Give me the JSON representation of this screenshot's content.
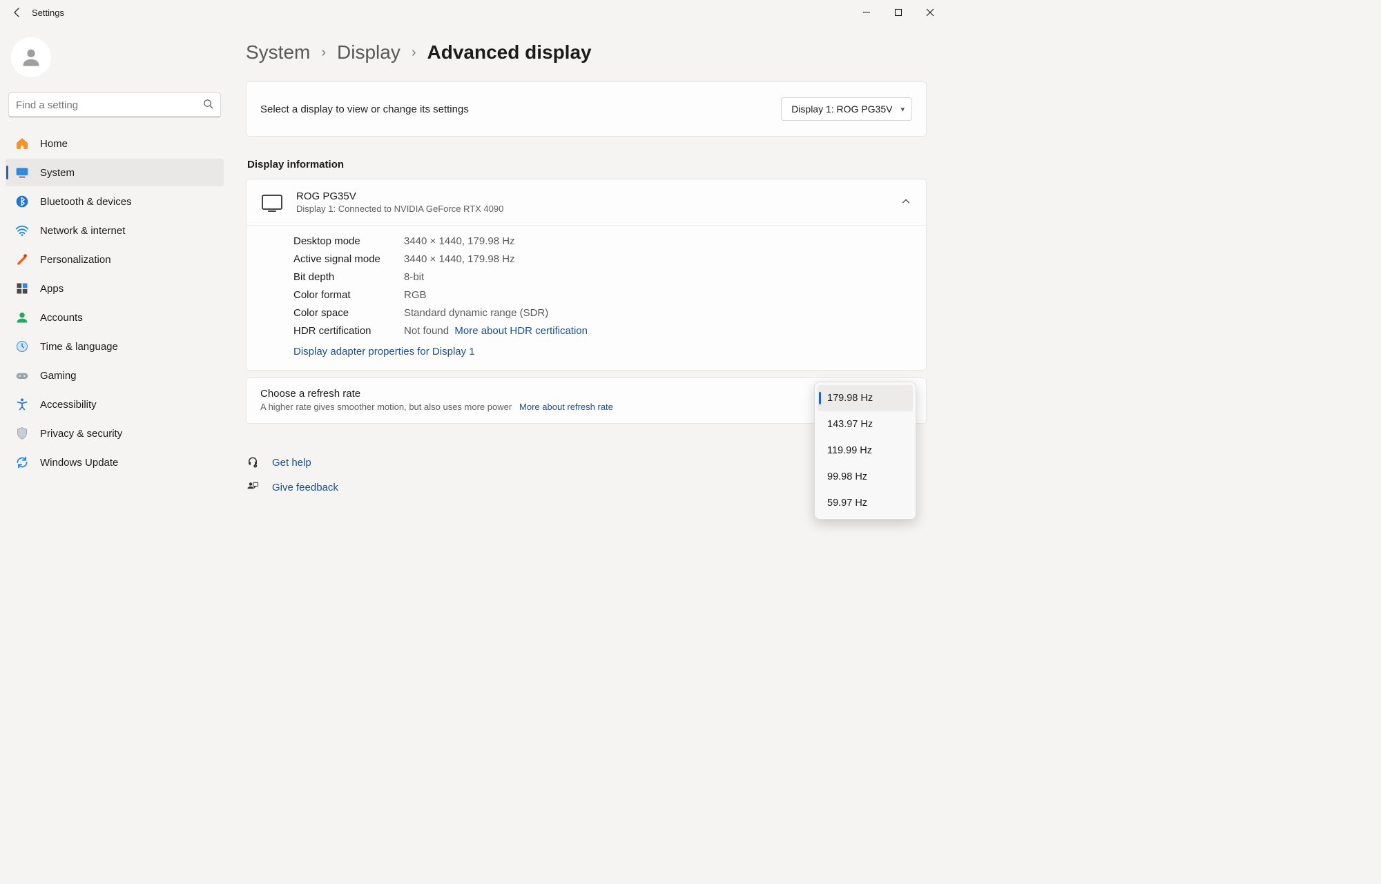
{
  "window": {
    "title": "Settings"
  },
  "search": {
    "placeholder": "Find a setting"
  },
  "nav": {
    "home": "Home",
    "system": "System",
    "bluetooth": "Bluetooth & devices",
    "network": "Network & internet",
    "personalization": "Personalization",
    "apps": "Apps",
    "accounts": "Accounts",
    "time": "Time & language",
    "gaming": "Gaming",
    "accessibility": "Accessibility",
    "privacy": "Privacy & security",
    "update": "Windows Update"
  },
  "breadcrumb": {
    "l1": "System",
    "l2": "Display",
    "current": "Advanced display"
  },
  "selector": {
    "label": "Select a display to view or change its settings",
    "value": "Display 1: ROG PG35V"
  },
  "section_display_info": "Display information",
  "display_header": {
    "name": "ROG PG35V",
    "sub": "Display 1: Connected to NVIDIA GeForce RTX 4090"
  },
  "props": {
    "desktop_mode_k": "Desktop mode",
    "desktop_mode_v": "3440 × 1440, 179.98 Hz",
    "active_signal_k": "Active signal mode",
    "active_signal_v": "3440 × 1440, 179.98 Hz",
    "bit_depth_k": "Bit depth",
    "bit_depth_v": "8-bit",
    "color_format_k": "Color format",
    "color_format_v": "RGB",
    "color_space_k": "Color space",
    "color_space_v": "Standard dynamic range (SDR)",
    "hdr_cert_k": "HDR certification",
    "hdr_cert_v": "Not found",
    "hdr_link": "More about HDR certification",
    "adapter_link": "Display adapter properties for Display 1"
  },
  "refresh": {
    "title": "Choose a refresh rate",
    "sub": "A higher rate gives smoother motion, but also uses more power",
    "sub_link": "More about refresh rate",
    "options": [
      "179.98 Hz",
      "143.97 Hz",
      "119.99 Hz",
      "99.98 Hz",
      "59.97 Hz"
    ],
    "selected": "179.98 Hz"
  },
  "footer": {
    "help": "Get help",
    "feedback": "Give feedback"
  }
}
